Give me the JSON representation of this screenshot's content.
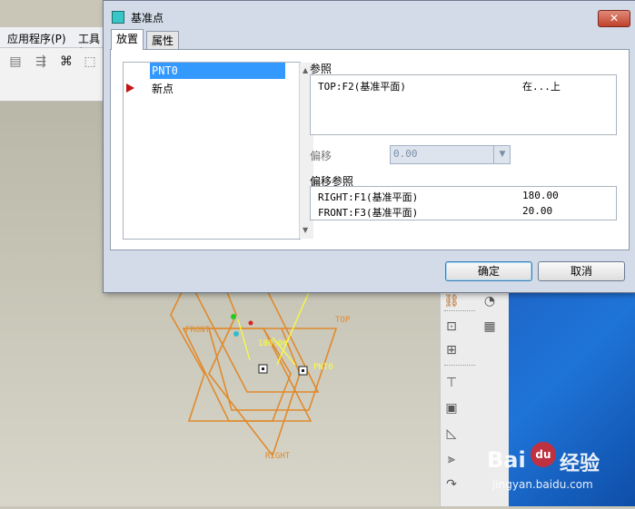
{
  "app": {
    "menu": [
      "应用程序(P)",
      "工具("
    ]
  },
  "model_labels": {
    "front": "FRONT",
    "top": "TOP",
    "right": "RIGHT",
    "pnt0": "PNT0",
    "offset_dim": "180.00"
  },
  "dialog": {
    "title": "基准点",
    "close_label": "✕",
    "tabs": [
      {
        "label": "放置",
        "active": true
      },
      {
        "label": "属性",
        "active": false
      }
    ],
    "point_list": [
      {
        "label": "PNT0",
        "selected": true
      },
      {
        "label": "新点",
        "selected": false
      }
    ],
    "references": {
      "label": "参照",
      "rows": [
        {
          "ref": "TOP:F2(基准平面)",
          "type": "在...上"
        }
      ]
    },
    "offset": {
      "label": "偏移",
      "value": "0.00"
    },
    "offset_references": {
      "label": "偏移参照",
      "rows": [
        {
          "ref": "RIGHT:F1(基准平面)",
          "value": "180.00"
        },
        {
          "ref": "FRONT:F3(基准平面)",
          "value": "20.00"
        }
      ]
    },
    "ok_label": "确定",
    "cancel_label": "取消"
  },
  "watermark": {
    "brand": "Bai",
    "paw": "du",
    "tagline": "经验",
    "url": "jingyan.baidu.com"
  },
  "colors": {
    "selection": "#3399ff",
    "model_lines": "#e08a2c",
    "desktop": "#1f74d8",
    "marker": "#c21414"
  }
}
